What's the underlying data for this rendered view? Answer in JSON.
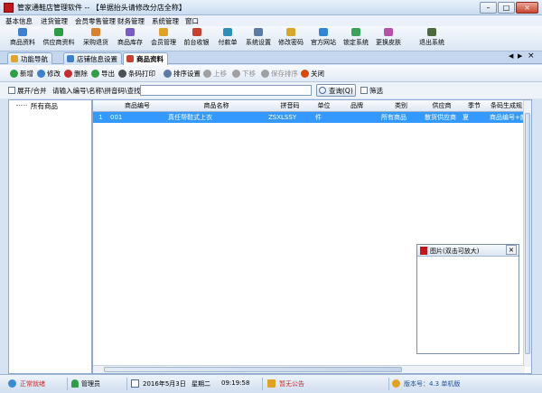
{
  "window": {
    "title": "管家通鞋店管理软件 -- 【单据抬头请修改分店全称】",
    "buttons": {
      "minimize": "–",
      "maximize": "□",
      "close": "×"
    }
  },
  "menu": [
    "基本信息",
    "进货管理",
    "会员零售管理",
    "财务管理",
    "系统管理",
    "窗口"
  ],
  "toolbar": [
    {
      "label": "商品资料",
      "icon": "goods-icon",
      "color": "#3d7fd0"
    },
    {
      "label": "供应商资料",
      "icon": "supplier-icon",
      "color": "#2e9b45"
    },
    {
      "label": "采购退货",
      "icon": "purchase-return-icon",
      "color": "#d9822b"
    },
    {
      "label": "商品库存",
      "icon": "inventory-icon",
      "color": "#7a5cc9"
    },
    {
      "label": "会员管理",
      "icon": "member-icon",
      "color": "#e0a321"
    },
    {
      "label": "前台收银",
      "icon": "cashier-icon",
      "color": "#c9402e"
    },
    {
      "label": "付款单",
      "icon": "payment-icon",
      "color": "#2b8fb8"
    },
    {
      "label": "系统设置",
      "icon": "settings-icon",
      "color": "#5c7aa6"
    },
    {
      "label": "修改密码",
      "icon": "password-icon",
      "color": "#d6a82a"
    },
    {
      "label": "官方网站",
      "icon": "website-icon",
      "color": "#2f86d9"
    },
    {
      "label": "锁定系统",
      "icon": "lock-icon",
      "color": "#3aa35a"
    },
    {
      "label": "更换皮肤",
      "icon": "skin-icon",
      "color": "#b84fa8"
    },
    {
      "label": "退出系统",
      "icon": "exit-icon",
      "color": "#4b6b3d"
    }
  ],
  "tabs": [
    {
      "label": "功能导航",
      "active": false,
      "color": "#e2a52b"
    },
    {
      "label": "店铺信息设置",
      "active": false,
      "color": "#3d7fd0"
    },
    {
      "label": "商品资料",
      "active": true,
      "color": "#c9402e"
    }
  ],
  "tab_controls": {
    "prev": "◀",
    "next": "▶",
    "close": "×"
  },
  "actions": [
    {
      "label": "新增",
      "icon": "add-icon",
      "color": "#2f9e44",
      "disabled": false
    },
    {
      "label": "修改",
      "icon": "edit-icon",
      "color": "#3d7fd0",
      "disabled": false
    },
    {
      "label": "删除",
      "icon": "delete-icon",
      "color": "#c92a2a",
      "disabled": false
    },
    {
      "label": "导出",
      "icon": "export-icon",
      "color": "#2f9e44",
      "disabled": false
    },
    {
      "label": "条码打印",
      "icon": "barcode-icon",
      "color": "#495057",
      "disabled": false
    },
    {
      "label": "排序设置",
      "icon": "sort-icon",
      "color": "#5c7aa6",
      "disabled": false
    },
    {
      "label": "上移",
      "icon": "up-icon",
      "color": "#a0a0a0",
      "disabled": true
    },
    {
      "label": "下移",
      "icon": "down-icon",
      "color": "#a0a0a0",
      "disabled": true
    },
    {
      "label": "保存排序",
      "icon": "save-sort-icon",
      "color": "#a0a0a0",
      "disabled": true
    },
    {
      "label": "关闭",
      "icon": "close-icon",
      "color": "#d9480f",
      "disabled": false
    }
  ],
  "search": {
    "expand_label": "展开/合并",
    "prompt": "请输入编号\\名称\\拼音码\\查找:",
    "value": "",
    "query_label": "查询(Q)",
    "filter_label": "筛选"
  },
  "tree": {
    "root": "所有商品"
  },
  "table": {
    "headers": [
      "",
      "商品编号",
      "商品名称",
      "拼音码",
      "单位",
      "品牌",
      "类别",
      "供应商",
      "季节",
      "条码生成规"
    ],
    "rows": [
      [
        "1",
        "001",
        "真任帮鞋式上衣",
        "ZSXLSSY",
        "件",
        "",
        "所有商品",
        "散货供应商",
        "夏",
        "商品编号+颜色"
      ]
    ]
  },
  "image_popup": {
    "title": "图片(双击可放大)",
    "close": "×"
  },
  "status": {
    "state": "正常就绪",
    "user": "管理员",
    "date": "2016年5月3日",
    "weekday": "星期二",
    "time": "09:19:58",
    "notice": "暂无公告",
    "version": "版本号：4.3 单机版"
  }
}
